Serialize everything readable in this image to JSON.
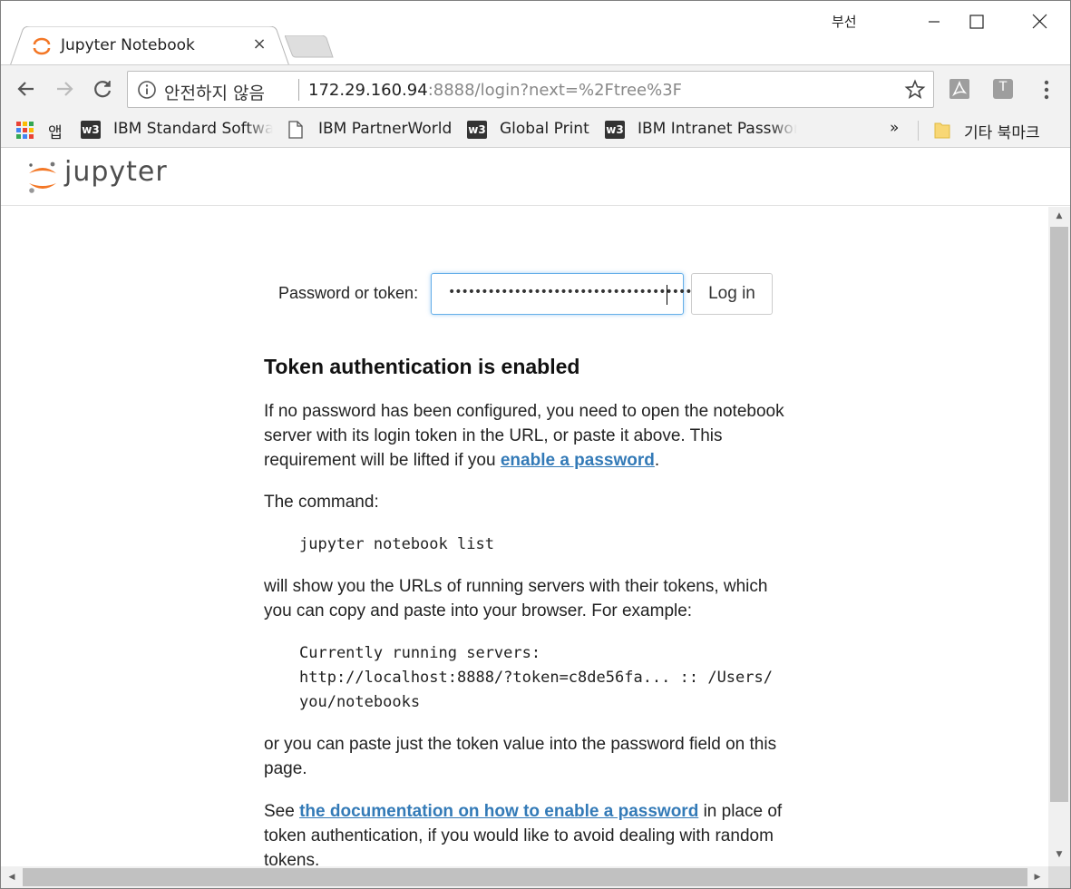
{
  "window": {
    "tab_title": "Jupyter Notebook",
    "tab_close": "×",
    "user_label": "부선"
  },
  "toolbar": {
    "insecure_label": "안전하지 않음",
    "url_host": "172.29.160.94",
    "url_rest": ":8888/login?next=%2Ftree%3F",
    "ext_t_label": "T"
  },
  "bookmarks": {
    "apps": "앱",
    "items": [
      {
        "label": "IBM Standard Software",
        "icon": "w3"
      },
      {
        "label": "IBM PartnerWorld",
        "icon": "page-icon"
      },
      {
        "label": "Global Print",
        "icon": "w3"
      },
      {
        "label": "IBM Intranet Password",
        "icon": "w3"
      }
    ],
    "overflow": "»",
    "other": "기타 북마크"
  },
  "jupyter": {
    "logo_text": "jupyter"
  },
  "login": {
    "label": "Password or token:",
    "password_value": "••••••••••••••••••••••••••••••••••••••",
    "button": "Log in"
  },
  "doc": {
    "heading": "Token authentication is enabled",
    "p1_before": "If no password has been configured, you need to open the notebook server with its login token in the URL, or paste it above. This requirement will be lifted if you ",
    "p1_link": "enable a password",
    "p1_after": ".",
    "p2": "The command:",
    "code1": "jupyter notebook list",
    "p3": "will show you the URLs of running servers with their tokens, which you can copy and paste into your browser. For example:",
    "code2_line1": "Currently running servers:",
    "code2_line2": "http://localhost:8888/?token=c8de56fa... :: /Users/",
    "code2_line3": "you/notebooks",
    "p4": "or you can paste just the token value into the password field on this page.",
    "p5_before": "See ",
    "p5_link": "the documentation on how to enable a password",
    "p5_after": " in place of token authentication, if you would like to avoid dealing with random tokens."
  },
  "colors": {
    "link": "#337ab7",
    "jupyter_orange": "#f37726",
    "focus_border": "#66afe9"
  }
}
